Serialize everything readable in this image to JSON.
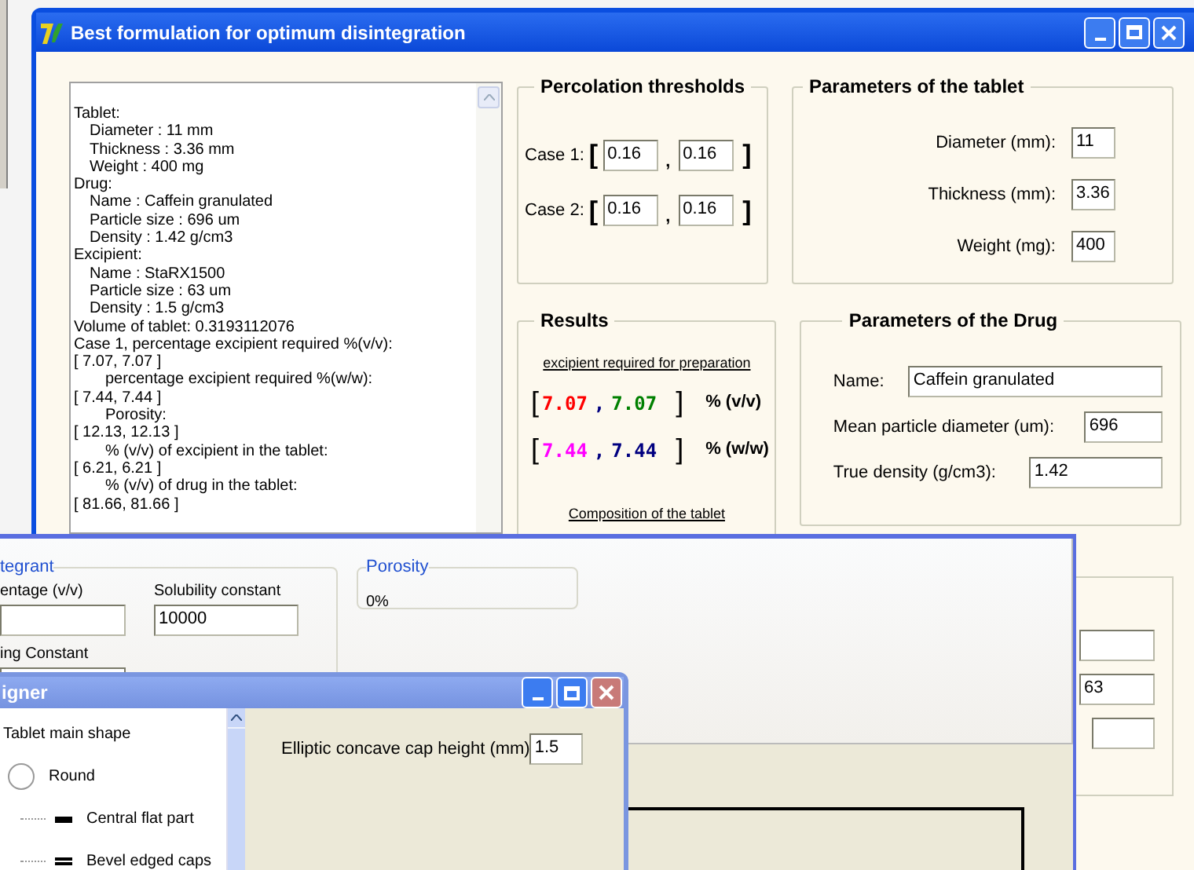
{
  "main_window": {
    "title": "Best formulation for optimum disintegration",
    "report": [
      {
        "kind": "label",
        "text": "Tablet:"
      },
      {
        "kind": "item",
        "text": "Diameter : 11 mm"
      },
      {
        "kind": "item",
        "text": "Thickness : 3.36 mm"
      },
      {
        "kind": "item",
        "text": "Weight : 400 mg"
      },
      {
        "kind": "label",
        "text": "Drug:"
      },
      {
        "kind": "item",
        "text": "Name : Caffein granulated"
      },
      {
        "kind": "item",
        "text": "Particle size : 696 um"
      },
      {
        "kind": "item",
        "text": "Density : 1.42 g/cm3"
      },
      {
        "kind": "label",
        "text": "Excipient:"
      },
      {
        "kind": "item",
        "text": "Name : StaRX1500"
      },
      {
        "kind": "item",
        "text": "Particle size : 63 um"
      },
      {
        "kind": "item",
        "text": "Density : 1.5 g/cm3"
      },
      {
        "kind": "label",
        "text": "Volume of tablet: 0.3193112076"
      },
      {
        "kind": "label",
        "text": "Case 1, percentage excipient required %(v/v):"
      },
      {
        "kind": "label",
        "text": "[ 7.07, 7.07 ]"
      },
      {
        "kind": "note",
        "text": "percentage excipient required %(w/w):"
      },
      {
        "kind": "label",
        "text": "[ 7.44, 7.44 ]"
      },
      {
        "kind": "note",
        "text": "Porosity:"
      },
      {
        "kind": "label",
        "text": "[ 12.13, 12.13 ]"
      },
      {
        "kind": "note",
        "text": "% (v/v) of excipient in the tablet:"
      },
      {
        "kind": "label",
        "text": "[ 6.21, 6.21 ]"
      },
      {
        "kind": "note",
        "text": "% (v/v) of drug in the tablet:"
      },
      {
        "kind": "label",
        "text": "[ 81.66, 81.66 ]"
      }
    ],
    "percolation": {
      "title": "Percolation thresholds",
      "cases": [
        {
          "label": "Case 1:",
          "open": "[",
          "sep": ",",
          "close": "]",
          "values": [
            "0.16",
            "0.16"
          ]
        },
        {
          "label": "Case 2:",
          "open": "[",
          "sep": ",",
          "close": "]",
          "values": [
            "0.16",
            "0.16"
          ]
        }
      ]
    },
    "tablet": {
      "title": "Parameters of the tablet",
      "fields": [
        {
          "label": "Diameter (mm):",
          "value": "11"
        },
        {
          "label": "Thickness (mm):",
          "value": "3.36"
        },
        {
          "label": "Weight (mg):",
          "value": "400"
        }
      ]
    },
    "results": {
      "title": "Results",
      "caption": "excipient required for  preparation",
      "rows": [
        {
          "open": "[",
          "close": "]",
          "unit": "% (v/v)",
          "values": [
            {
              "text": "7.07",
              "color": "#ff0000"
            },
            {
              "text": ",",
              "color": "#000080"
            },
            {
              "text": "7.07",
              "color": "#008000"
            }
          ]
        },
        {
          "open": "[",
          "close": "]",
          "unit": "% (w/w)",
          "values": [
            {
              "text": "7.44",
              "color": "#ff00ff"
            },
            {
              "text": ",",
              "color": "#000080"
            },
            {
              "text": "7.44",
              "color": "#000080"
            }
          ]
        }
      ],
      "link": "Composition of the tablet"
    },
    "drug": {
      "title": "Parameters of the Drug",
      "fields": [
        {
          "label": "Name:",
          "value": "Caffein granulated",
          "kind": "wide"
        },
        {
          "label": "Mean particle diameter (um):",
          "value": "696",
          "kind": "short"
        },
        {
          "label": "True density (g/cm3):",
          "value": "1.42",
          "kind": "medium"
        }
      ]
    },
    "excipient_group": {
      "fields": [
        {
          "kind": "wide"
        },
        {
          "kind": "wide",
          "value": "63"
        },
        {
          "kind": "short"
        }
      ]
    }
  },
  "middle_window": {
    "disintegrant_group": {
      "title": "tegrant",
      "fields": [
        {
          "label": "entage (v/v)"
        },
        {
          "label": "Solubility constant",
          "value": "10000"
        },
        {
          "label": "ing Constant",
          "kind": "clipped"
        }
      ]
    },
    "porosity": {
      "title": "Porosity",
      "value": "0%"
    }
  },
  "designer_window": {
    "title": "igner",
    "tree": [
      {
        "text": "Tablet main shape",
        "kind": "root",
        "children": [
          {
            "text": "Round",
            "kind": "circle",
            "children": [
              {
                "text": "Central flat part",
                "kind": "single"
              },
              {
                "text": "Bevel edged caps",
                "kind": "double"
              }
            ]
          }
        ]
      }
    ],
    "field": {
      "label": "Elliptic concave cap height (mm)",
      "value": "1.5"
    }
  }
}
